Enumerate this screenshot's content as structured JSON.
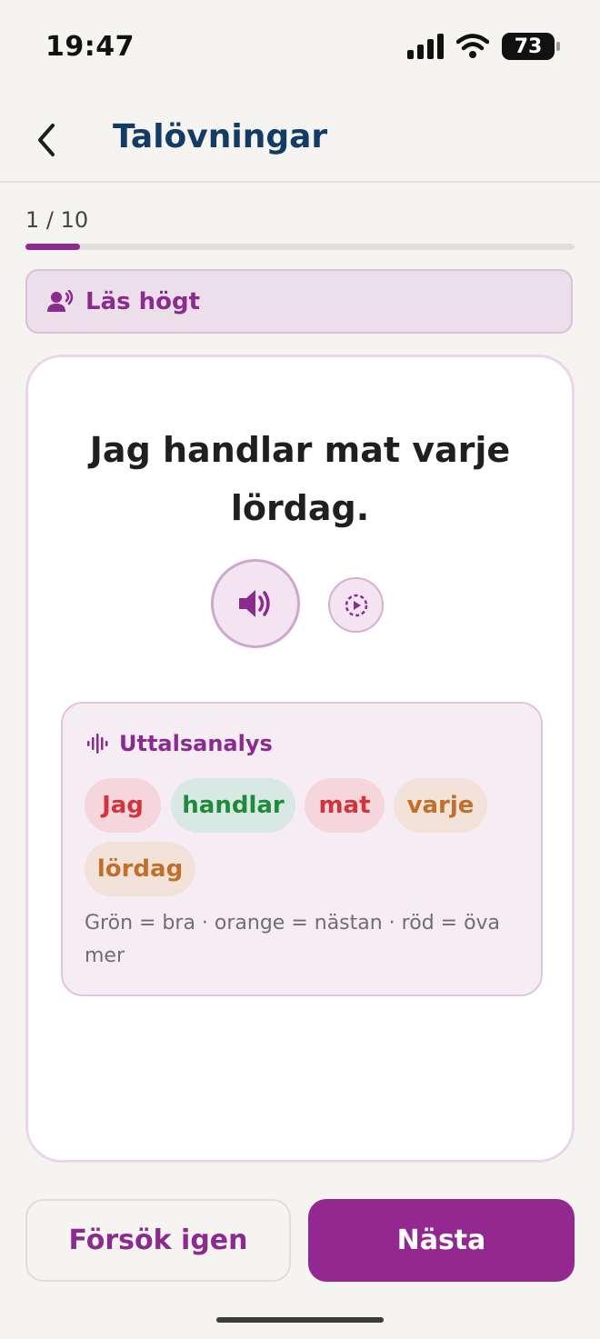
{
  "status_bar": {
    "time": "19:47",
    "battery": "73"
  },
  "header": {
    "title": "Talövningar",
    "back_icon": "chevron-left-icon"
  },
  "progress": {
    "counter": "1 / 10",
    "fraction": 0.1,
    "color": "#8f2a93"
  },
  "instruction": {
    "label": "Läs högt",
    "icon": "speaking-person-icon"
  },
  "exercise": {
    "sentence": "Jag handlar mat varje lördag.",
    "play_icon": "speaker-icon",
    "slow_play_icon": "slow-play-icon"
  },
  "analysis": {
    "title": "Uttalsanalys",
    "icon": "waveform-icon",
    "words": [
      {
        "text": "Jag",
        "rating": "poor",
        "color": "#d0343d",
        "bg": "#f5d6dc"
      },
      {
        "text": "handlar",
        "rating": "good",
        "color": "#1e8a3a",
        "bg": "#d8e8e2"
      },
      {
        "text": "mat",
        "rating": "poor",
        "color": "#d0343d",
        "bg": "#f5d6dc"
      },
      {
        "text": "varje",
        "rating": "almost",
        "color": "#c0702a",
        "bg": "#f3e2da"
      },
      {
        "text": "lördag",
        "rating": "almost",
        "color": "#c0702a",
        "bg": "#f3e2da"
      }
    ],
    "legend": "Grön = bra · orange = nästan · röd = öva mer"
  },
  "buttons": {
    "retry": "Försök igen",
    "next": "Nästa"
  }
}
